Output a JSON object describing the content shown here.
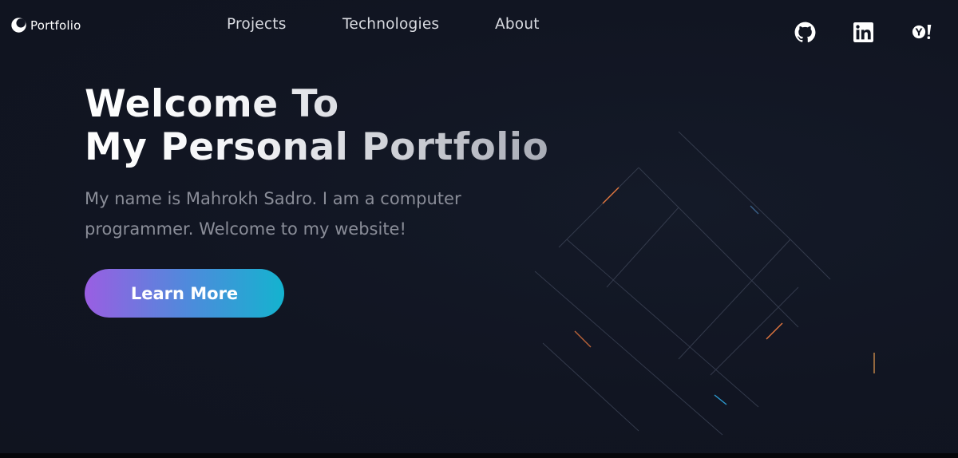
{
  "header": {
    "logo_text": "Portfolio",
    "nav": [
      {
        "label": "Projects"
      },
      {
        "label": "Technologies"
      },
      {
        "label": "About"
      }
    ],
    "social": [
      {
        "icon": "github-icon"
      },
      {
        "icon": "linkedin-icon"
      },
      {
        "icon": "yahoo-icon"
      }
    ]
  },
  "hero": {
    "title_line1": "Welcome To",
    "title_line2": "My Personal Portfolio",
    "description": "My name is Mahrokh Sadro. I am a computer programmer. Welcome to my website!",
    "cta_label": "Learn More"
  },
  "colors": {
    "background": "#111522",
    "cta_gradient_start": "#9a5ee2",
    "cta_gradient_end": "#14b3cf",
    "accent_orange": "#e2773f",
    "accent_blue": "#2d9bd1"
  }
}
